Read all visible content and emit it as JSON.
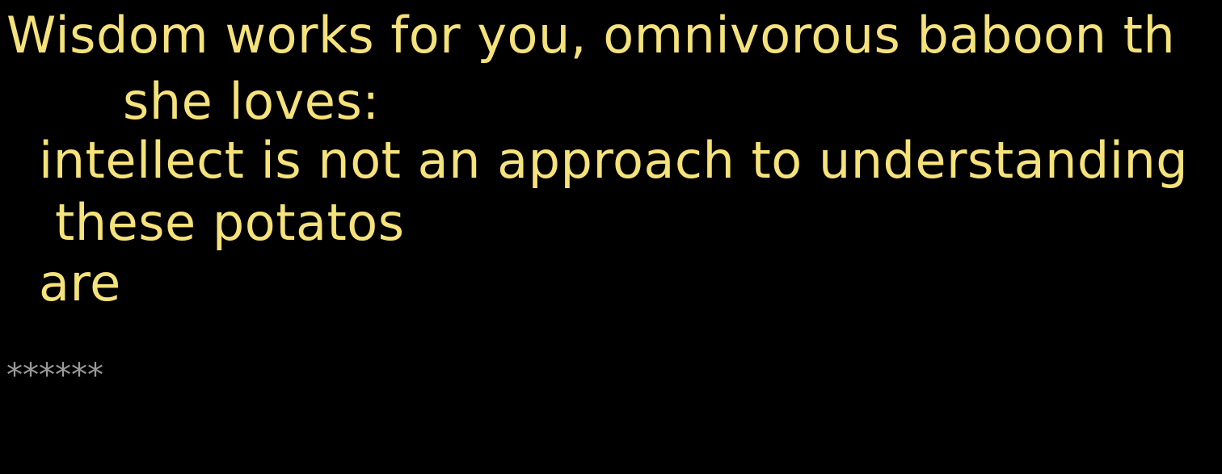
{
  "poem": {
    "lines": [
      "Wisdom works for you, omnivorous baboon th",
      "she loves:",
      "intellect is not an approach to understanding",
      "these potatos",
      "are"
    ]
  },
  "separator": "******"
}
